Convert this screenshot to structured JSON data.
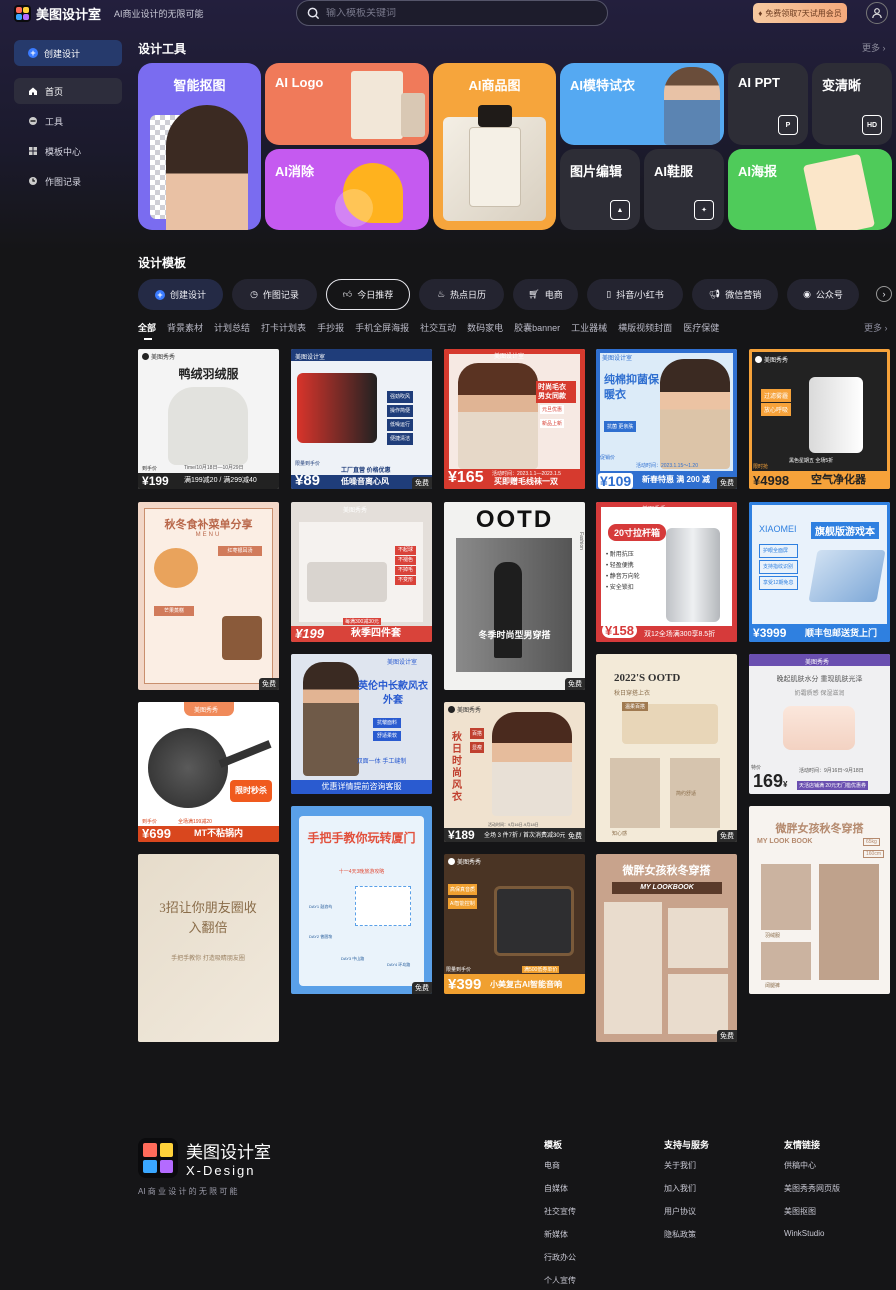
{
  "header": {
    "logo_text": "美图设计室",
    "slogan": "AI商业设计的无限可能",
    "search_placeholder": "输入模板关键词",
    "vip_text": "免费领取7天试用会员"
  },
  "sidebar": {
    "create_label": "创建设计",
    "items": [
      {
        "label": "首页",
        "icon": "home-icon",
        "active": true
      },
      {
        "label": "工具",
        "icon": "toolbox-icon",
        "active": false
      },
      {
        "label": "模板中心",
        "icon": "grid-icon",
        "active": false
      },
      {
        "label": "作图记录",
        "icon": "clock-icon",
        "active": false
      }
    ]
  },
  "tools_section": {
    "title": "设计工具",
    "more": "更多",
    "tools": [
      {
        "label": "智能抠图",
        "color": "#7a6cf0"
      },
      {
        "label": "AI Logo",
        "color": "#f07a5a"
      },
      {
        "label": "AI商品图",
        "color": "#f6a53c"
      },
      {
        "label": "AI模特试衣",
        "color": "#55a9f2"
      },
      {
        "label": "AI PPT",
        "color": "#2d2d36"
      },
      {
        "label": "变清晰",
        "color": "#2d2d36"
      },
      {
        "label": "AI消除",
        "color": "#c55af0"
      },
      {
        "label": "图片编辑",
        "color": "#2d2d36"
      },
      {
        "label": "AI鞋服",
        "color": "#2d2d36"
      },
      {
        "label": "AI海报",
        "color": "#4fcb5a"
      }
    ]
  },
  "templates_section": {
    "title": "设计模板",
    "tabs": [
      {
        "label": "创建设计",
        "icon": "plus-icon"
      },
      {
        "label": "作图记录",
        "icon": "clock-icon"
      },
      {
        "label": "今日推荐",
        "icon": "thumb-icon"
      },
      {
        "label": "热点日历",
        "icon": "fire-icon"
      },
      {
        "label": "电商",
        "icon": "cart-icon"
      },
      {
        "label": "抖音/小红书",
        "icon": "phone-icon"
      },
      {
        "label": "微信营销",
        "icon": "megaphone-icon"
      },
      {
        "label": "公众号",
        "icon": "user-circle-icon"
      }
    ],
    "categories": [
      "全部",
      "背景素材",
      "计划总结",
      "打卡计划表",
      "手抄报",
      "手机全屏海报",
      "社交互动",
      "数码家电",
      "胶囊banner",
      "工业器械",
      "横版视频封面",
      "医疗保健"
    ],
    "more": "更多"
  },
  "cards": [
    {
      "title": "鸭绒羽绒服",
      "brand": "美图秀秀",
      "price": "199",
      "sub": "满199减20 / 满299减40",
      "date": "Time/10月18日—10月29日",
      "price_note": "到手价"
    },
    {
      "title": "工厂直营 价格优惠",
      "brand": "美图设计室",
      "price": "89",
      "sub": "低噪音离心风",
      "free": "免费",
      "price_note": "限量到手价",
      "bullets": [
        "强劲吹风",
        "操作简便",
        "低噪运行",
        "便捷清洁"
      ]
    },
    {
      "title": "时尚毛衣 男女同款",
      "brand": "美图设计室",
      "price": "165",
      "sub": "买即赠毛线袜一双",
      "date": "活动时间：2023.1.1—2023.1.5",
      "tags": [
        "元旦优惠",
        "新品上新"
      ]
    },
    {
      "title": "纯棉抑菌保暖衣",
      "brand": "美图设计室",
      "price": "109",
      "sub": "新春特惠 满 200 减",
      "date": "活动时间：2023.1.15～1.20",
      "free": "免费",
      "price_note": "促销价",
      "tag": "抗菌 更亲肤"
    },
    {
      "title": "空气净化器",
      "brand": "美图秀秀",
      "price": "4998",
      "sub": "黑色星期五 全场5折",
      "tags": [
        "过滤雾霾",
        "放心呼吸"
      ],
      "price_note": "限时抢"
    },
    {
      "title": "秋冬食补菜单分享",
      "sub": "MENU",
      "free": "免费",
      "sections": [
        "红枣银耳汤",
        "芒果蒸糕"
      ]
    },
    {
      "title": "秋季四件套",
      "brand": "美图秀秀",
      "price": "199",
      "sub": "每满300减30元",
      "tags": [
        "不起球",
        "不褪色",
        "不掉毛",
        "不变形"
      ]
    },
    {
      "title": "OOTD",
      "sub": "冬季时尚型男穿搭",
      "side": "Fashion",
      "free": "免费"
    },
    {
      "title": "20寸拉杆箱",
      "brand": "美图秀秀",
      "price": "158",
      "sub": "双12全场满300享8.5折",
      "bullets": [
        "耐用抗压",
        "轻盈便携",
        "静音万向轮",
        "安全锁扣"
      ]
    },
    {
      "title": "旗舰版游戏本",
      "brand": "XIAOMEI",
      "price": "3999",
      "sub": "顺丰包邮送货上门",
      "bullets": [
        "护眼全面屏",
        "支持指纹识别",
        "享受12期免息"
      ]
    },
    {
      "title": "英伦中长款风衣外套",
      "brand": "美图设计室",
      "sub": "优惠详情提前咨询客服",
      "tags": [
        "双面一体 手工缝制",
        "抗皱面料",
        "舒适柔软"
      ]
    },
    {
      "title": "秋日时尚风衣",
      "brand": "美图秀秀",
      "price": "189",
      "sub": "全场 3 件7折 / 首次消费减30元",
      "date": "活动时间：9月16日-9月18日",
      "free": "免费",
      "tags": [
        "百搭",
        "显瘦"
      ]
    },
    {
      "title": "2022'S OOTD",
      "sub": "秋日穿搭上衣",
      "free": "免费",
      "tags": [
        "温柔百搭",
        "简约舒适",
        "知心感"
      ]
    },
    {
      "title": "限时秒杀",
      "brand": "美图秀秀",
      "price": "699",
      "sub": "MT不粘锅内",
      "date": "全场满199减20",
      "price_note": "到手价"
    },
    {
      "title": "手把手教你玩转厦门",
      "brand": "美图设计室",
      "sub": "十一4天3晚旅游攻略",
      "free": "免费",
      "tags": [
        "DAY1 鼓浪屿",
        "DAY2 曾厝垵",
        "DAY3 中山路",
        "DAY4 环岛路"
      ]
    },
    {
      "title": "晚起肌肤水分 重现肌肤光泽",
      "brand": "美图秀秀",
      "price": "169",
      "sub": "天活店铺满 20元无门槛优惠券",
      "date": "活动时间：9月16日~9月18日",
      "tag": "奶霜质感 保湿滋润",
      "price_note": "特价"
    },
    {
      "title": "3招让你朋友圈收入翻倍",
      "sub": "手把手教你 打造吸睛朋友圈"
    },
    {
      "title": "小美复古AI智能音响",
      "brand": "美图秀秀",
      "price": "399",
      "sub": "满500低券单价",
      "tags": [
        "高保真音质",
        "AI智能控制"
      ],
      "price_note": "限量到手价"
    },
    {
      "title": "微胖女孩秋冬穿搭",
      "sub": "MY LOOKBOOK",
      "free": "免费"
    },
    {
      "title": "微胖女孩秋冬穿搭",
      "sub": "MY LOOK BOOK",
      "tags": [
        "65kg",
        "160cm",
        "秋冬新款",
        "百搭显瘦",
        "羽绒服",
        "阔腿裤"
      ]
    }
  ],
  "footer": {
    "logo_text": "美图设计室",
    "logo_sub": "X-Design",
    "slogan": "AI 商 业 设 计 的 无 限 可 能",
    "columns": [
      {
        "title": "模板",
        "links": [
          "电商",
          "自媒体",
          "社交宣传",
          "新媒体",
          "行政办公",
          "个人宣传"
        ]
      },
      {
        "title": "支持与服务",
        "links": [
          "关于我们",
          "加入我们",
          "用户协议",
          "隐私政策"
        ]
      },
      {
        "title": "友情链接",
        "links": [
          "供稿中心",
          "美图秀秀网页版",
          "美图抠图",
          "WinkStudio"
        ]
      }
    ]
  }
}
